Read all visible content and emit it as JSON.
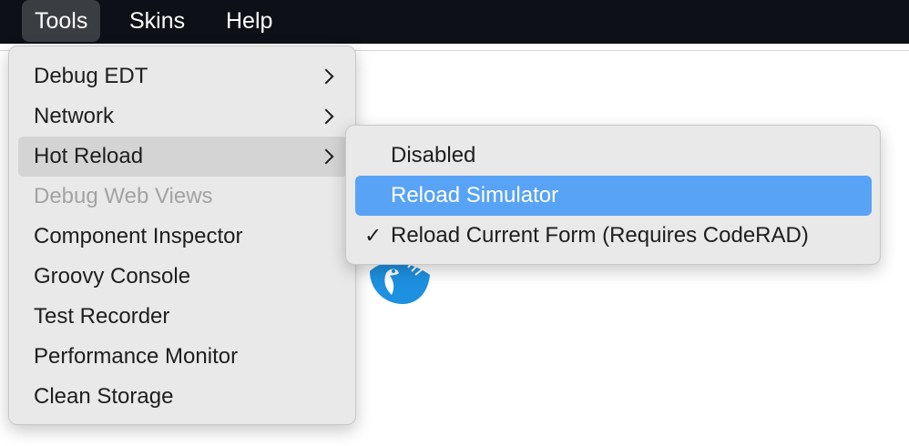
{
  "menubar": {
    "items": [
      {
        "label": "Tools"
      },
      {
        "label": "Skins"
      },
      {
        "label": "Help"
      }
    ]
  },
  "tools_menu": {
    "items": [
      {
        "label": "Debug EDT",
        "submenu": true
      },
      {
        "label": "Network",
        "submenu": true
      },
      {
        "label": "Hot Reload",
        "submenu": true,
        "highlighted": true
      },
      {
        "label": "Debug Web Views",
        "disabled": true
      },
      {
        "label": "Component Inspector"
      },
      {
        "label": "Groovy Console"
      },
      {
        "label": "Test Recorder"
      },
      {
        "label": "Performance Monitor"
      },
      {
        "label": "Clean Storage"
      }
    ]
  },
  "hot_reload_submenu": {
    "items": [
      {
        "label": "Disabled",
        "checked": false
      },
      {
        "label": "Reload Simulator",
        "checked": false,
        "selected": true
      },
      {
        "label": "Reload Current Form (Requires CodeRAD)",
        "checked": true
      }
    ],
    "check_glyph": "✓"
  },
  "colors": {
    "menubar_bg": "#0d1117",
    "menu_bg": "#e9e9e9",
    "selection_blue": "#58a3f5",
    "logo_blue": "#1e90e0"
  }
}
